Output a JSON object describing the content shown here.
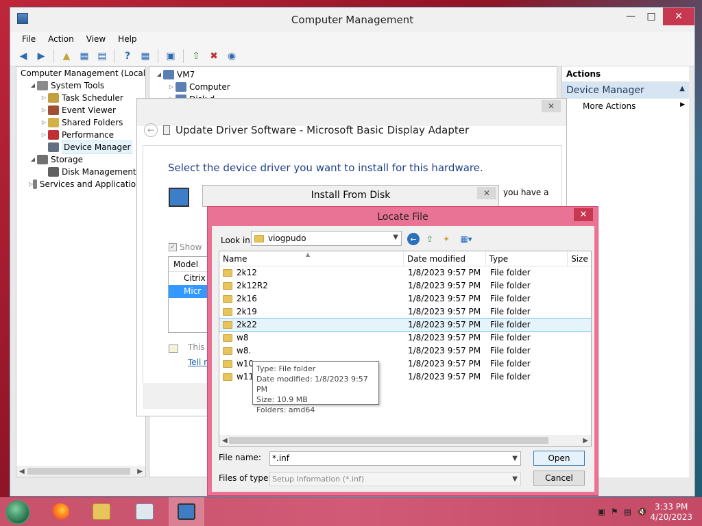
{
  "main_window": {
    "title": "Computer Management",
    "menu": [
      "File",
      "Action",
      "View",
      "Help"
    ],
    "tree": [
      {
        "label": "Computer Management (Local",
        "indent": 0,
        "arrow": "",
        "color": "#5a7fb5"
      },
      {
        "label": "System Tools",
        "indent": 1,
        "arrow": "◢",
        "color": "#8a8a8a"
      },
      {
        "label": "Task Scheduler",
        "indent": 2,
        "arrow": "▷",
        "color": "#c0a040"
      },
      {
        "label": "Event Viewer",
        "indent": 2,
        "arrow": "▷",
        "color": "#a05030"
      },
      {
        "label": "Shared Folders",
        "indent": 2,
        "arrow": "▷",
        "color": "#d4b04a"
      },
      {
        "label": "Performance",
        "indent": 2,
        "arrow": "▷",
        "color": "#c03030"
      },
      {
        "label": "Device Manager",
        "indent": 2,
        "arrow": "",
        "color": "#607080",
        "selected": true
      },
      {
        "label": "Storage",
        "indent": 1,
        "arrow": "◢",
        "color": "#707070"
      },
      {
        "label": "Disk Management",
        "indent": 2,
        "arrow": "",
        "color": "#606060"
      },
      {
        "label": "Services and Applications",
        "indent": 1,
        "arrow": "▷",
        "color": "#808080"
      }
    ],
    "center_tree": [
      {
        "label": "VM7",
        "indent": 0
      },
      {
        "label": "Computer",
        "indent": 1
      },
      {
        "label": "Disk d...",
        "indent": 1
      }
    ],
    "actions": {
      "header": "Actions",
      "group": "Device Manager",
      "item": "More Actions"
    }
  },
  "update_driver": {
    "title": "Update Driver Software - Microsoft Basic Display Adapter",
    "heading": "Select the device driver you want to install for this hardware.",
    "have_disk_fragment": "you have a",
    "show_label": "Show",
    "model_header": "Model",
    "models": [
      "Citrix",
      "Micr"
    ],
    "signed_fragment": "This d",
    "link_fragment": "Tell m"
  },
  "install_from_disk": {
    "title": "Install From Disk"
  },
  "locate_file": {
    "title": "Locate File",
    "look_in_label": "Look in:",
    "look_in_value": "viogpudo",
    "columns": [
      "Name",
      "Date modified",
      "Type",
      "Size"
    ],
    "rows": [
      {
        "name": "2k12",
        "date": "1/8/2023 9:57 PM",
        "type": "File folder"
      },
      {
        "name": "2k12R2",
        "date": "1/8/2023 9:57 PM",
        "type": "File folder"
      },
      {
        "name": "2k16",
        "date": "1/8/2023 9:57 PM",
        "type": "File folder"
      },
      {
        "name": "2k19",
        "date": "1/8/2023 9:57 PM",
        "type": "File folder"
      },
      {
        "name": "2k22",
        "date": "1/8/2023 9:57 PM",
        "type": "File folder",
        "hover": true
      },
      {
        "name": "w8",
        "date": "1/8/2023 9:57 PM",
        "type": "File folder"
      },
      {
        "name": "w8.",
        "date": "1/8/2023 9:57 PM",
        "type": "File folder"
      },
      {
        "name": "w10",
        "date": "1/8/2023 9:57 PM",
        "type": "File folder"
      },
      {
        "name": "w11",
        "date": "1/8/2023 9:57 PM",
        "type": "File folder"
      }
    ],
    "tooltip": [
      "Type: File folder",
      "Date modified: 1/8/2023 9:57 PM",
      "Size: 10.9 MB",
      "Folders: amd64"
    ],
    "file_name_label": "File name:",
    "file_name_value": "*.inf",
    "file_type_label": "Files of type:",
    "file_type_value": "Setup Information (*.inf)",
    "open_label": "Open",
    "cancel_label": "Cancel"
  },
  "taskbar": {
    "apps": [
      "start-button",
      "firefox",
      "file-explorer",
      "performance-monitor",
      "computer-management"
    ],
    "time": "3:33 PM",
    "date": "4/20/2023"
  },
  "colors": {
    "dialog_accent": "#e97395",
    "taskbar": "#cf5773",
    "selection": "#3399ff"
  }
}
